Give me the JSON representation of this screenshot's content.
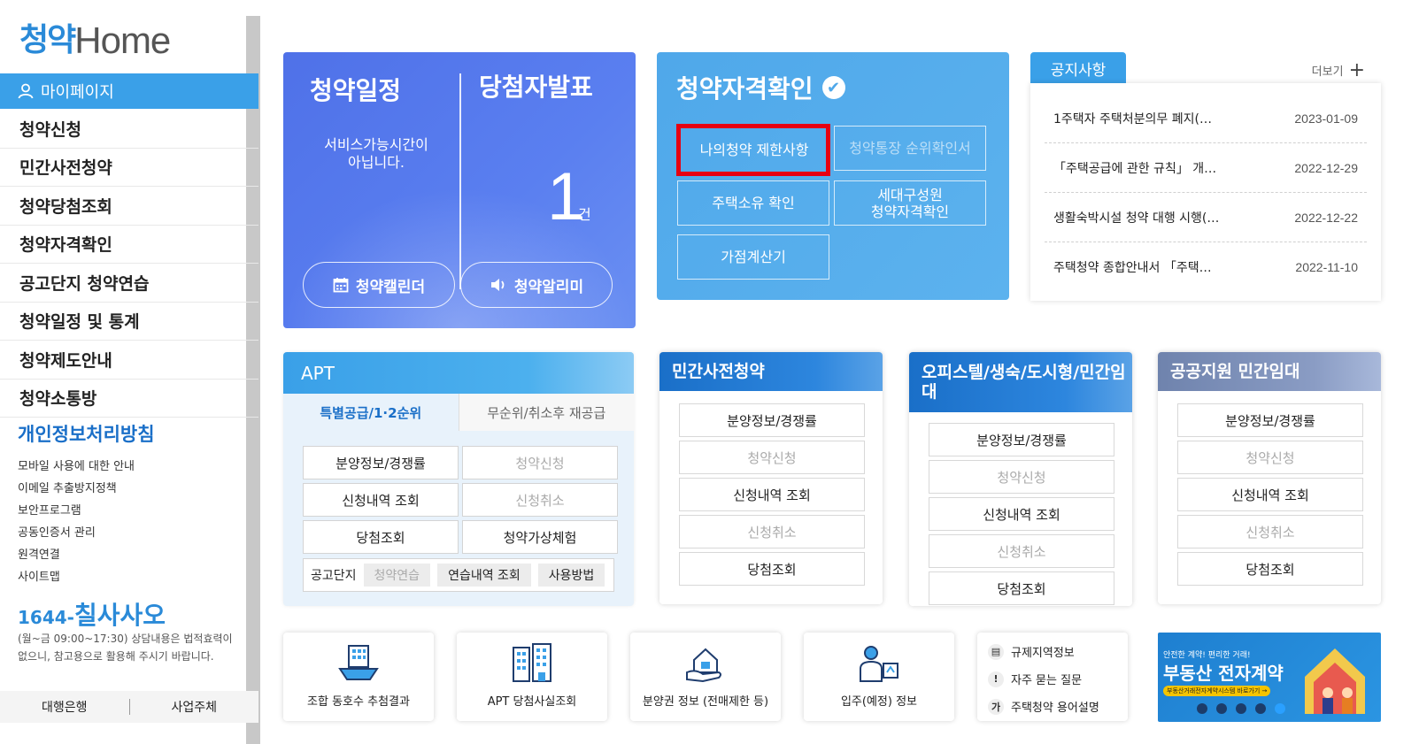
{
  "logo": {
    "korean": "청약",
    "english": "Home"
  },
  "sidebar": {
    "mypage_label": "마이페이지",
    "menu": [
      "청약신청",
      "민간사전청약",
      "청약당첨조회",
      "청약자격확인",
      "공고단지 청약연습",
      "청약일정 및 통계",
      "청약제도안내",
      "청약소통방"
    ],
    "privacy_title": "개인정보처리방침",
    "links": [
      "모바일 사용에 대한 안내",
      "이메일 추출방지정책",
      "보안프로그램",
      "공동인증서 관리",
      "원격연결",
      "사이트맵"
    ],
    "phone_number": "1644-",
    "phone_word": "칠사사오",
    "phone_note": "(월~금 09:00~17:30) 상담내용은 법적효력이 없으니, 참고용으로 활용해 주시기 바랍니다.",
    "bottom_links": [
      "대행은행",
      "사업주체"
    ]
  },
  "schedule": {
    "title": "청약일정",
    "note": "서비스가능시간이 아닙니다.",
    "winner_title": "당첨자발표",
    "count": "1",
    "unit": "건",
    "calendar_btn": "청약캘린더",
    "alarm_btn": "청약알리미"
  },
  "eligibility": {
    "title": "청약자격확인",
    "buttons": {
      "restriction": "나의청약 제한사항",
      "ranking": "청약통장 순위확인서",
      "housing": "주택소유 확인",
      "household": "세대구성원\n청약자격확인",
      "score": "가점계산기"
    }
  },
  "notice": {
    "tab": "공지사항",
    "more": "더보기",
    "items": [
      {
        "title": "1주택자 주택처분의무 폐지(…",
        "date": "2023-01-09"
      },
      {
        "title": "「주택공급에 관한 규칙」 개…",
        "date": "2022-12-29"
      },
      {
        "title": "생활숙박시설 청약 대행 시행(…",
        "date": "2022-12-22"
      },
      {
        "title": "주택청약 종합안내서 「주택…",
        "date": "2022-11-10"
      }
    ]
  },
  "apt": {
    "title": "APT",
    "tab_active": "특별공급/1·2순위",
    "tab_inactive": "무순위/취소후 재공급",
    "buttons": [
      "분양정보/경쟁률",
      "청약신청",
      "신청내역 조회",
      "신청취소",
      "당첨조회",
      "청약가상체험"
    ],
    "practice_label": "공고단지",
    "chips": [
      "청약연습",
      "연습내역 조회",
      "사용방법"
    ]
  },
  "cards": [
    {
      "title": "민간사전청약",
      "buttons": [
        "분양정보/경쟁률",
        "청약신청",
        "신청내역 조회",
        "신청취소",
        "당첨조회"
      ]
    },
    {
      "title": "오피스텔/생숙/도시형/민간임대",
      "buttons": [
        "분양정보/경쟁률",
        "청약신청",
        "신청내역 조회",
        "신청취소",
        "당첨조회"
      ]
    },
    {
      "title": "공공지원 민간임대",
      "buttons": [
        "분양정보/경쟁률",
        "청약신청",
        "신청내역 조회",
        "신청취소",
        "당첨조회"
      ]
    }
  ],
  "quick_links": [
    "조합 동호수 추첨결과",
    "APT 당첨사실조회",
    "분양권 정보 (전매제한 등)",
    "입주(예정) 정보"
  ],
  "quick_list": [
    "규제지역정보",
    "자주 묻는 질문",
    "주택청약 용어설명"
  ],
  "banner": {
    "small": "안전한 계약! 편리한 거래!",
    "big": "부동산 전자계약",
    "pill": "부동산거래전자계약시스템 바로가기 →"
  },
  "colors": {
    "accent_blue": "#3aa0e8",
    "schedule_blue": "#5577ee",
    "highlight_red": "#e60012"
  }
}
